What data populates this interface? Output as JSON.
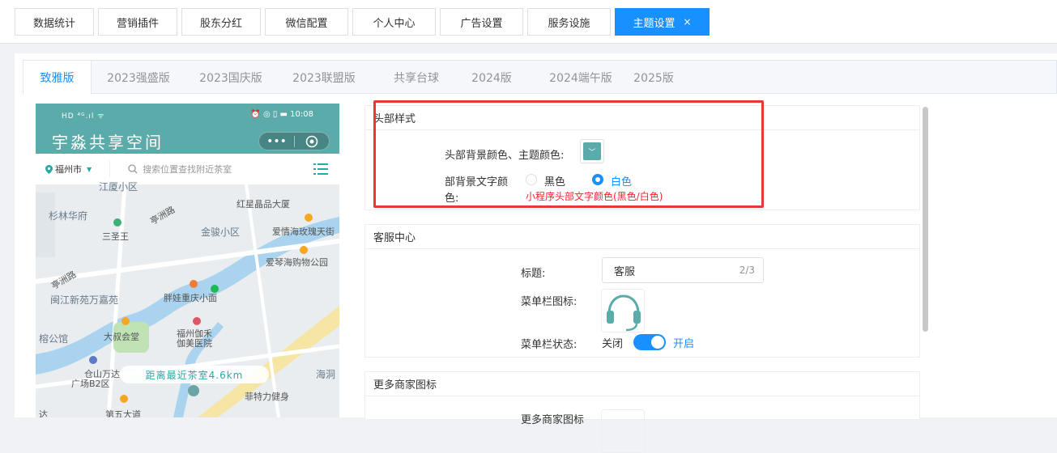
{
  "top_tabs": [
    {
      "label": "数据统计"
    },
    {
      "label": "营销插件"
    },
    {
      "label": "股东分红"
    },
    {
      "label": "微信配置"
    },
    {
      "label": "个人中心"
    },
    {
      "label": "广告设置"
    },
    {
      "label": "服务设施"
    },
    {
      "label": "主题设置",
      "active": true,
      "close": "×"
    }
  ],
  "theme_tabs": [
    "致雅版",
    "2023强盛版",
    "2023国庆版",
    "2023联盟版",
    "共享台球",
    "2024版",
    "2024端午版",
    "2025版"
  ],
  "phone": {
    "status_left": "HD ⁴ᴳ.ıl ᯤ",
    "status_right": "⏰ ◎ ▯ ▬ 10:08",
    "title": "宇淼共享空间",
    "capsule_dots": "•••",
    "city": "福州市",
    "search_placeholder": "搜索位置查找附近茶室",
    "distance": "距离最近茶室4.6km",
    "map_labels": {
      "l1": "江厦小区",
      "l2": "红星晶品大厦",
      "l3": "杉林华府",
      "l4": "亭洲路",
      "l5": "金骏小区",
      "l6": "爱情海玫瑰天街",
      "l7": "三圣王",
      "l8": "爱琴海购物公园",
      "l9": "亭洲路",
      "l10": "胖娃重庆小面",
      "l11": "闽江新苑万嘉苑",
      "l12": "福州伽禾",
      "l13": "伽美医院",
      "l14": "大叔会堂",
      "l15": "榕公馆",
      "l16": "仓山万达",
      "l17": "广场B2区",
      "l18": "海洞",
      "l19": "菲特力健身",
      "l20": "第五大道",
      "l21": "达"
    }
  },
  "header_card": {
    "title": "头部样式",
    "bg_color_label": "头部背景颜色、主题颜色:",
    "text_color_label_1": "部背景文字颜",
    "text_color_label_2": "色:",
    "option_black": "黑色",
    "option_white": "白色",
    "hint": "小程序头部文字颜色(黑色/白色)",
    "accent": "#5aaba9"
  },
  "service_card": {
    "title": "客服中心",
    "title_label": "标题:",
    "title_value": "客服",
    "title_count": "2/3",
    "icon_label": "菜单栏图标:",
    "status_label": "菜单栏状态:",
    "switch_off": "关闭",
    "switch_on": "开启"
  },
  "merchant_card": {
    "title": "更多商家图标",
    "icon_label": "更多商家图标"
  }
}
